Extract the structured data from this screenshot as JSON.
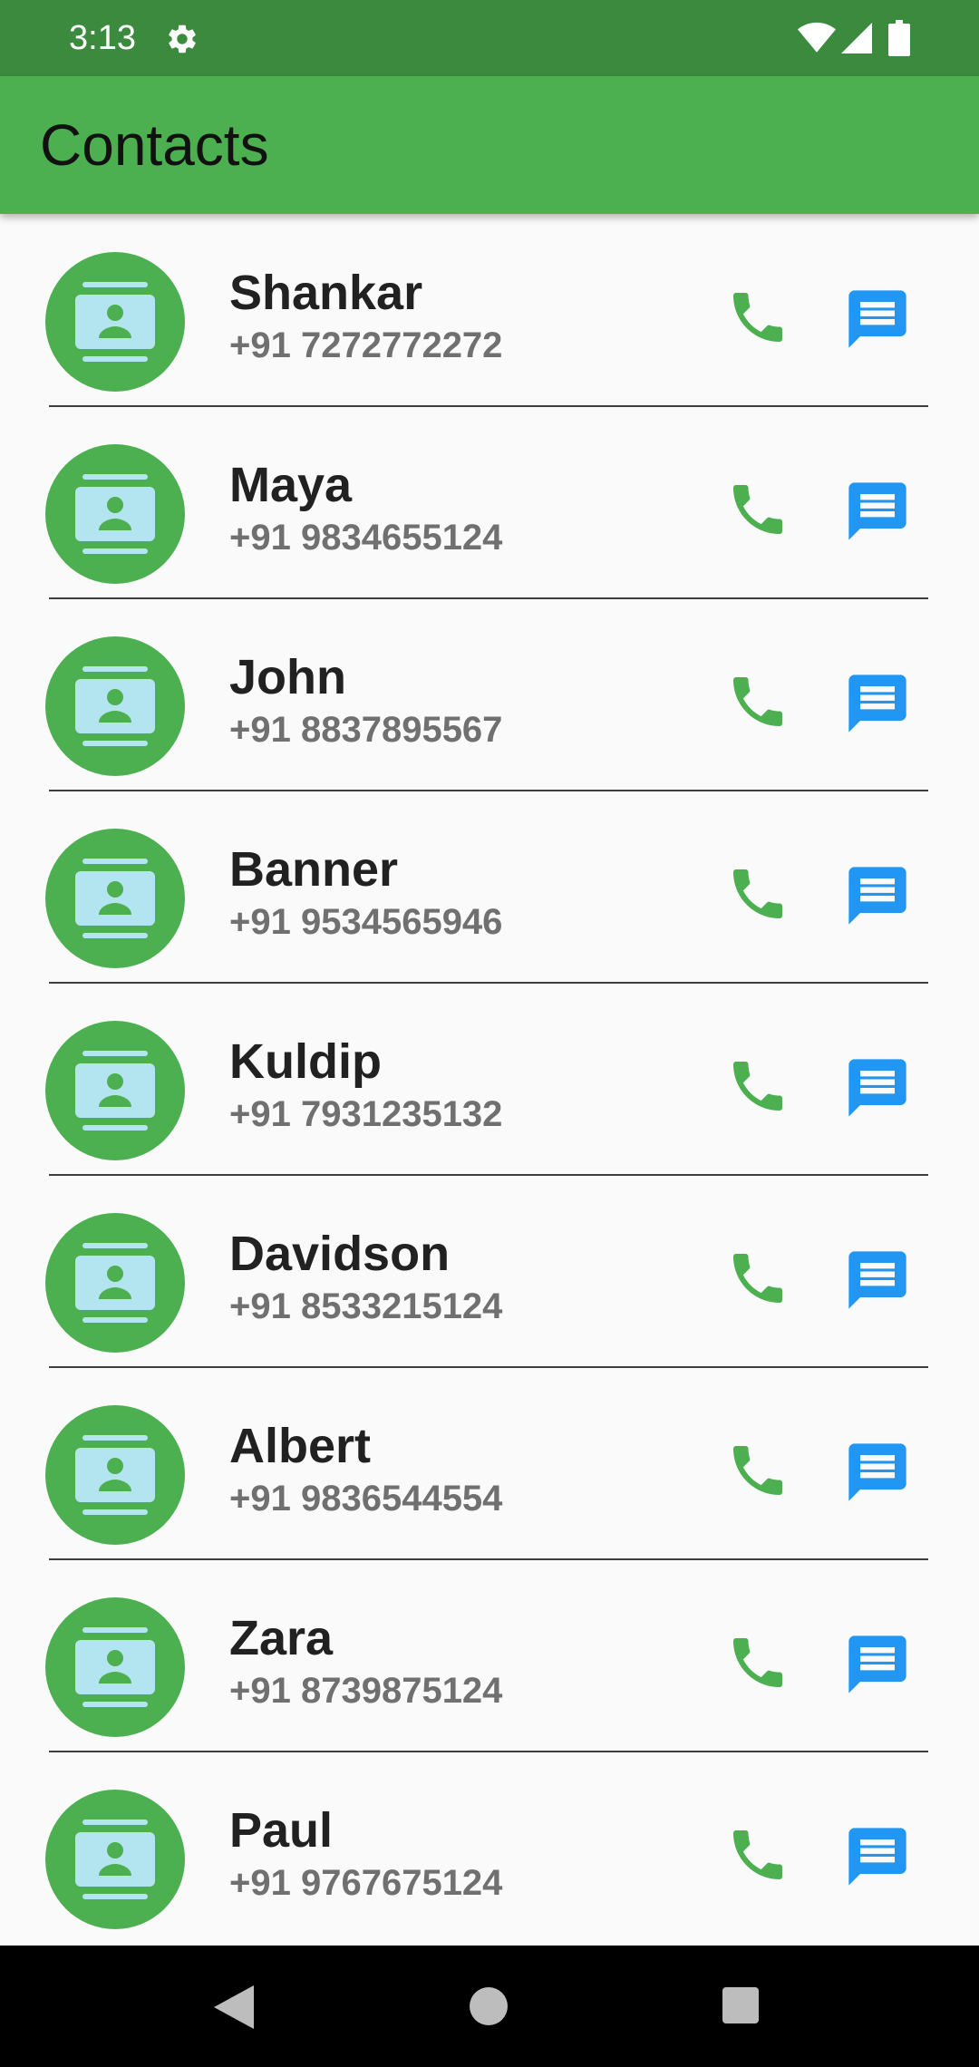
{
  "status_bar": {
    "time": "3:13",
    "icons": [
      "gear-icon",
      "wifi-icon",
      "signal-icon",
      "battery-icon"
    ]
  },
  "app_bar": {
    "title": "Contacts"
  },
  "colors": {
    "status_bar": "#3b8a3e",
    "app_bar": "#4caf50",
    "avatar_bg": "#4caf50",
    "avatar_card": "#b3e5f0",
    "call_icon": "#4caf50",
    "message_icon": "#2196f3",
    "nav_bar": "#000000"
  },
  "contacts": [
    {
      "name": "Shankar",
      "phone": "+91 7272772272"
    },
    {
      "name": "Maya",
      "phone": "+91 9834655124"
    },
    {
      "name": "John",
      "phone": "+91 8837895567"
    },
    {
      "name": "Banner",
      "phone": "+91 9534565946"
    },
    {
      "name": "Kuldip",
      "phone": "+91 7931235132"
    },
    {
      "name": "Davidson",
      "phone": "+91 8533215124"
    },
    {
      "name": "Albert",
      "phone": "+91 9836544554"
    },
    {
      "name": "Zara",
      "phone": "+91 8739875124"
    },
    {
      "name": "Paul",
      "phone": "+91 9767675124"
    }
  ],
  "row_icons": {
    "avatar": "contact-card-icon",
    "call": "phone-icon",
    "message": "message-icon"
  },
  "nav_bar": {
    "icons": [
      "back-icon",
      "home-icon",
      "recents-icon"
    ]
  }
}
